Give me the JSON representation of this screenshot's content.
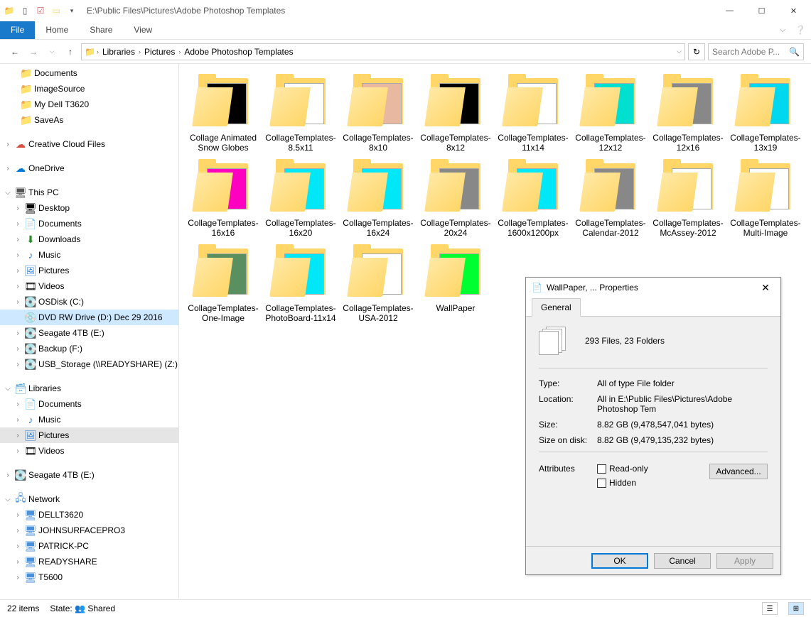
{
  "titlebar": {
    "path": "E:\\Public Files\\Pictures\\Adobe Photoshop Templates"
  },
  "ribbon": {
    "file": "File",
    "home": "Home",
    "share": "Share",
    "view": "View"
  },
  "breadcrumb": {
    "b0": "Libraries",
    "b1": "Pictures",
    "b2": "Adobe Photoshop Templates"
  },
  "search": {
    "placeholder": "Search Adobe P..."
  },
  "tree": {
    "docs": "Documents",
    "imgsrc": "ImageSource",
    "dell": "My Dell T3620",
    "saveas": "SaveAs",
    "ccf": "Creative Cloud Files",
    "od": "OneDrive",
    "pc": "This PC",
    "desk": "Desktop",
    "docs2": "Documents",
    "dl": "Downloads",
    "music": "Music",
    "pics": "Pictures",
    "vids": "Videos",
    "osc": "OSDisk (C:)",
    "dvd": "DVD RW Drive (D:) Dec 29 2016",
    "seag": "Seagate 4TB (E:)",
    "bk": "Backup (F:)",
    "usb": "USB_Storage (\\\\READYSHARE) (Z:)",
    "libs": "Libraries",
    "ldocs": "Documents",
    "lmus": "Music",
    "lpics": "Pictures",
    "lvids": "Videos",
    "seag2": "Seagate 4TB (E:)",
    "net": "Network",
    "n0": "DELLT3620",
    "n1": "JOHNSURFACEPRO3",
    "n2": "PATRICK-PC",
    "n3": "READYSHARE",
    "n4": "T5600"
  },
  "items": [
    {
      "name": "Collage Animated Snow Globes",
      "c": "#000"
    },
    {
      "name": "CollageTemplates-8.5x11",
      "c": "#fff"
    },
    {
      "name": "CollageTemplates-8x10",
      "c": "#e8b8a0"
    },
    {
      "name": "CollageTemplates-8x12",
      "c": "#000"
    },
    {
      "name": "CollageTemplates-11x14",
      "c": "#fff"
    },
    {
      "name": "CollageTemplates-12x12",
      "c": "#00e0d0"
    },
    {
      "name": "CollageTemplates-12x16",
      "c": "#888"
    },
    {
      "name": "CollageTemplates-13x19",
      "c": "#00d8f0"
    },
    {
      "name": "CollageTemplates-16x16",
      "c": "#ff00c0"
    },
    {
      "name": "CollageTemplates-16x20",
      "c": "#00e8f8"
    },
    {
      "name": "CollageTemplates-16x24",
      "c": "#00e8f8"
    },
    {
      "name": "CollageTemplates-20x24",
      "c": "#888"
    },
    {
      "name": "CollageTemplates-1600x1200px",
      "c": "#00e8f8"
    },
    {
      "name": "CollageTemplates-Calendar-2012",
      "c": "#888"
    },
    {
      "name": "CollageTemplates-McAssey-2012",
      "c": "#fff"
    },
    {
      "name": "CollageTemplates-Multi-Image",
      "c": "#fff"
    },
    {
      "name": "CollageTemplates-One-Image",
      "c": "#5a9060"
    },
    {
      "name": "CollageTemplates-PhotoBoard-11x14",
      "c": "#00e8f8"
    },
    {
      "name": "CollageTemplates-USA-2012",
      "c": "#fff"
    },
    {
      "name": "WallPaper",
      "c": "#00ff30"
    }
  ],
  "status": {
    "count": "22 items",
    "state": "State:",
    "shared": "Shared"
  },
  "dialog": {
    "title": "WallPaper, ... Properties",
    "tab": "General",
    "info": "293 Files,  23 Folders",
    "type_k": "Type:",
    "type_v": "All of type File folder",
    "loc_k": "Location:",
    "loc_v": "All in E:\\Public Files\\Pictures\\Adobe Photoshop Tem",
    "size_k": "Size:",
    "size_v": "8.82 GB (9,478,547,041 bytes)",
    "disk_k": "Size on disk:",
    "disk_v": "8.82 GB (9,479,135,232 bytes)",
    "attr": "Attributes",
    "ro": "Read-only",
    "hid": "Hidden",
    "adv": "Advanced...",
    "ok": "OK",
    "cancel": "Cancel",
    "apply": "Apply"
  }
}
